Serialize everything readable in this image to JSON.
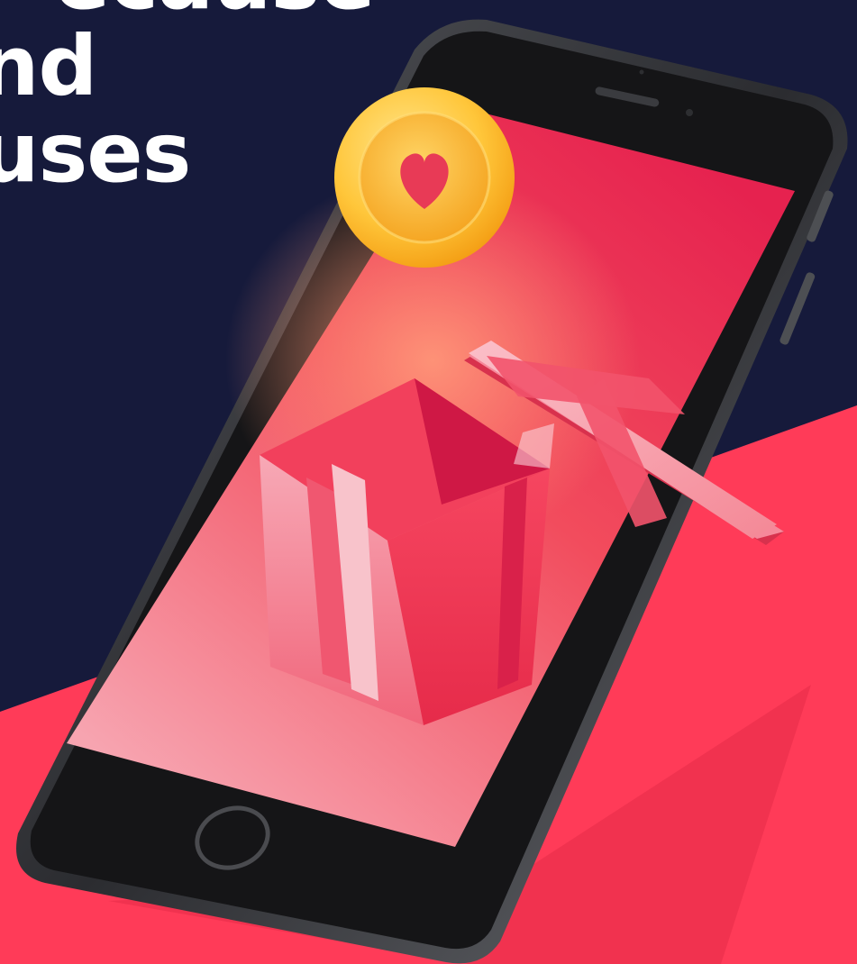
{
  "headline": {
    "line1": "ecause",
    "line2": "nd",
    "line3": "uses"
  },
  "colors": {
    "background_navy": "#161a3b",
    "accent_red": "#ff3b58",
    "phone_frame": "#2a2b2e",
    "screen_red": "#e6284f",
    "coin_gold": "#ffc93f",
    "heart": "#e83a56"
  },
  "icons": {
    "coin": "heart-coin-icon",
    "heart": "heart-icon",
    "gift": "gift-box-icon"
  }
}
